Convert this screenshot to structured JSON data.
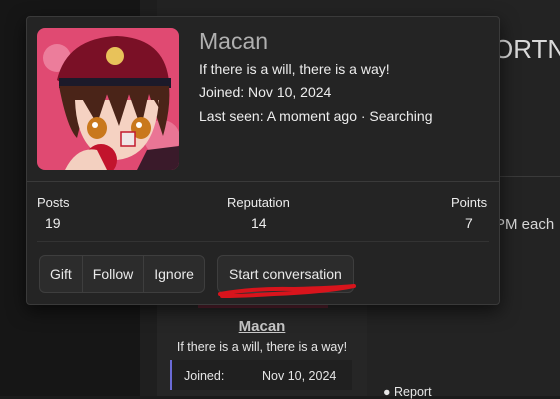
{
  "background": {
    "title_fragment": "ORTNA",
    "pm_fragment": "PM each",
    "user_card": {
      "username": "Macan",
      "slogan": "If there is a will, there is a way!",
      "joined_label": "Joined:",
      "joined_value": "Nov 10, 2024"
    },
    "report_label": "Report"
  },
  "card": {
    "name": "Macan",
    "slogan": "If there is a will, there is a way!",
    "joined": "Joined: Nov 10, 2024",
    "last_seen": "Last seen: A moment ago · Searching",
    "stats": {
      "posts_label": "Posts",
      "posts_value": "19",
      "reputation_label": "Reputation",
      "reputation_value": "14",
      "points_label": "Points",
      "points_value": "7"
    },
    "buttons": {
      "gift": "Gift",
      "follow": "Follow",
      "ignore": "Ignore",
      "start_conversation": "Start conversation"
    }
  },
  "colors": {
    "annotation_red": "#d8141c",
    "avatar_bg": "#e04a72"
  }
}
